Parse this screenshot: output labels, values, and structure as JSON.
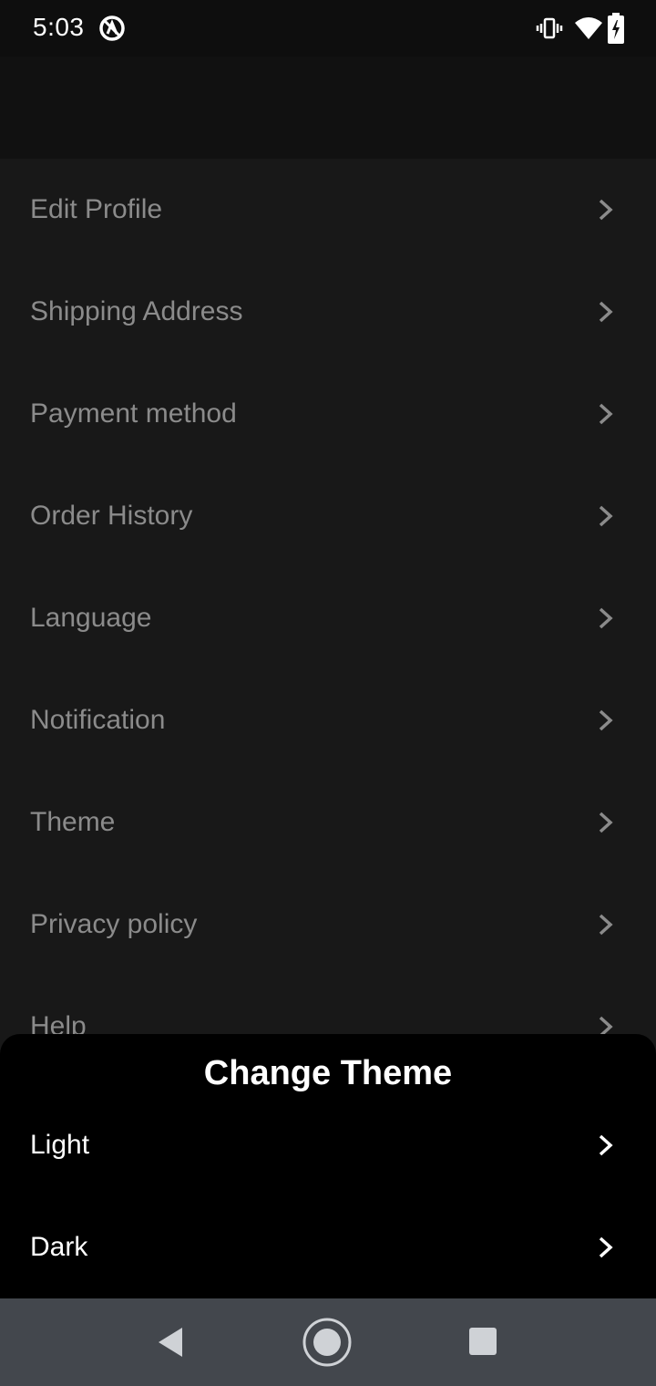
{
  "status_bar": {
    "time": "5:03",
    "icons": [
      "app-notification-icon",
      "vibrate-icon",
      "wifi-icon",
      "battery-charging-icon"
    ]
  },
  "settings": {
    "items": [
      {
        "label": "Edit Profile",
        "icon": "chevron-right-icon"
      },
      {
        "label": "Shipping Address",
        "icon": "chevron-right-icon"
      },
      {
        "label": "Payment method",
        "icon": "chevron-right-icon"
      },
      {
        "label": "Order History",
        "icon": "chevron-right-icon"
      },
      {
        "label": "Language",
        "icon": "chevron-right-icon"
      },
      {
        "label": "Notification",
        "icon": "chevron-right-icon"
      },
      {
        "label": "Theme",
        "icon": "chevron-right-icon"
      },
      {
        "label": "Privacy policy",
        "icon": "chevron-right-icon"
      },
      {
        "label": "Help",
        "icon": "chevron-right-icon"
      }
    ]
  },
  "theme_sheet": {
    "title": "Change Theme",
    "options": [
      {
        "label": "Light",
        "icon": "chevron-right-icon"
      },
      {
        "label": "Dark",
        "icon": "chevron-right-icon"
      }
    ]
  },
  "nav_bar": {
    "icons": [
      "back-icon",
      "home-icon",
      "recents-icon"
    ]
  },
  "colors": {
    "background": "#181818",
    "header": "#111111",
    "dimmed_text": "#8b8b8b",
    "sheet_background": "#000000",
    "sheet_text": "#ffffff",
    "nav_bar": "#43474d"
  }
}
